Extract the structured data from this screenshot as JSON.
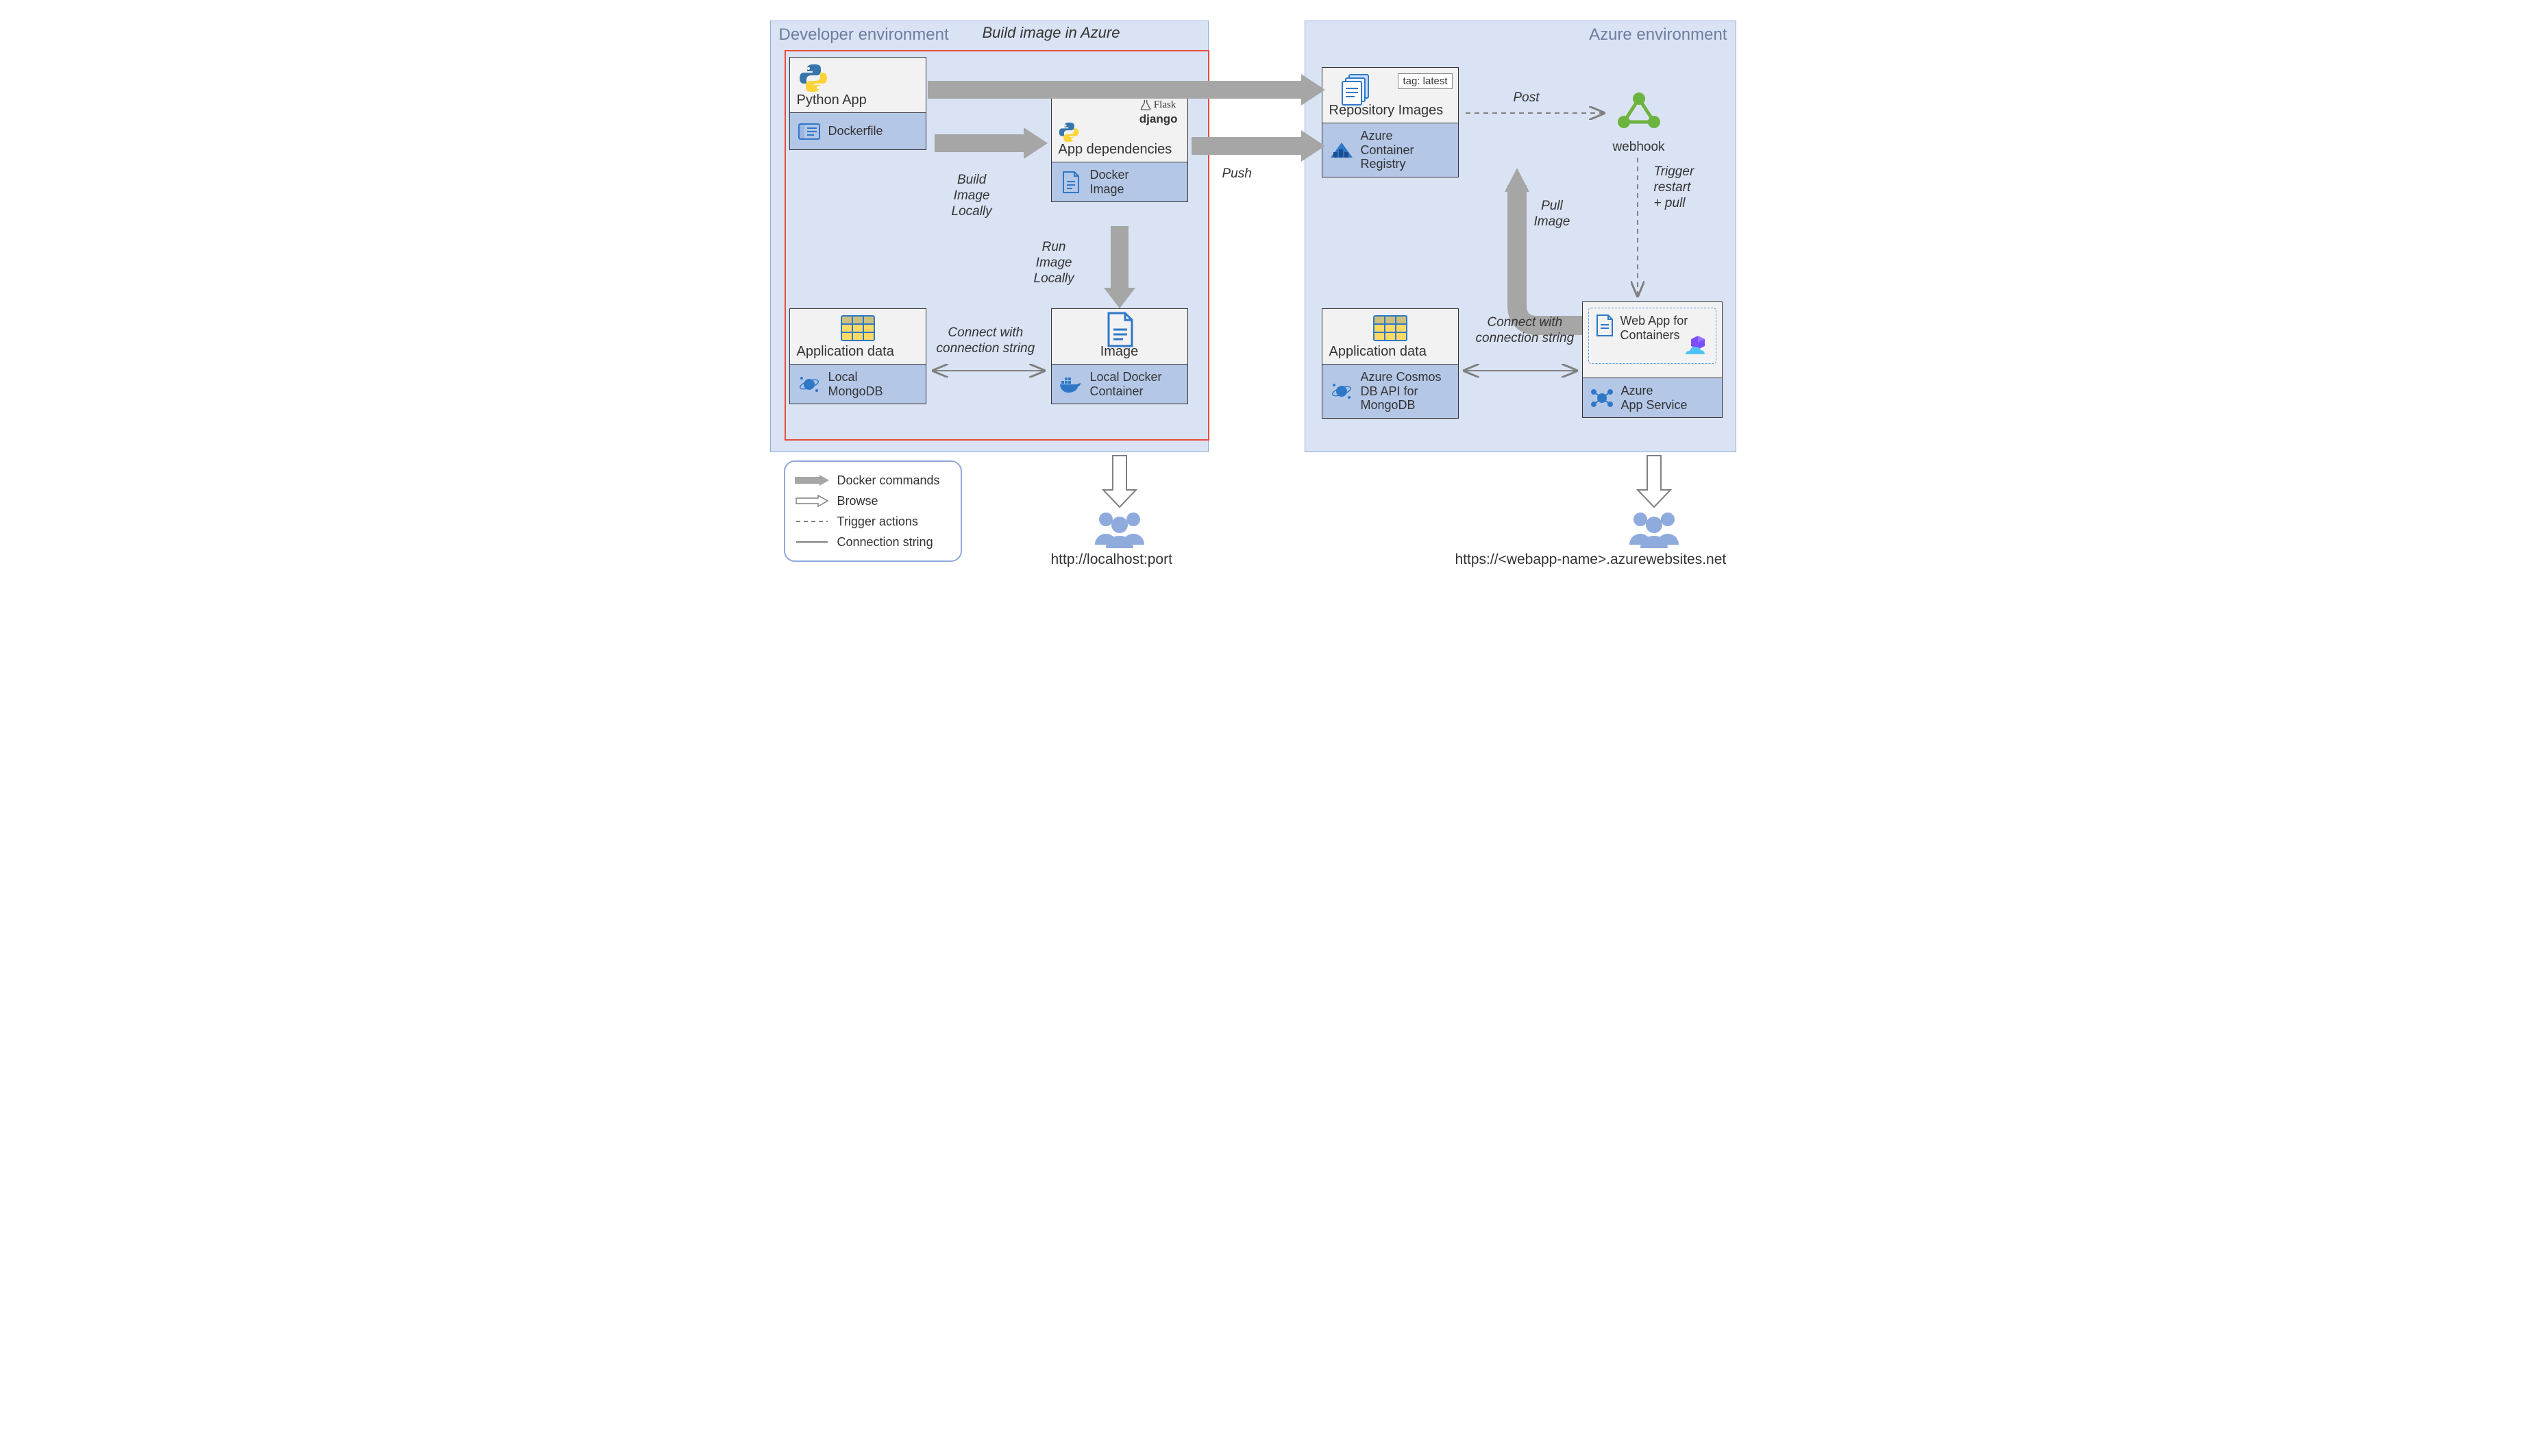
{
  "env": {
    "dev_label": "Developer environment",
    "azure_label": "Azure environment"
  },
  "labels": {
    "build_in_azure": "Build image in Azure",
    "build_locally": "Build\nImage\nLocally",
    "run_locally": "Run\nImage\nLocally",
    "conn_string": "Connect with\nconnection string",
    "conn_string2": "Connect with\nconnection string",
    "push": "Push",
    "post": "Post",
    "trigger": "Trigger\nrestart\n+ pull",
    "pull_image": "Pull\nImage",
    "tag_latest": "tag: latest"
  },
  "boxes": {
    "python_app": {
      "title": "Python App",
      "sub": "Dockerfile"
    },
    "app_deps": {
      "title": "App dependencies",
      "sub": "Docker\nImage",
      "frameworks": [
        "Flask",
        "django"
      ]
    },
    "app_data_local": {
      "title": "Application data",
      "sub": "Local\nMongoDB"
    },
    "image": {
      "title": "Image",
      "sub": "Local Docker\nContainer"
    },
    "repo_images": {
      "title": "Repository Images",
      "sub": "Azure\nContainer\nRegistry"
    },
    "webhook": "webhook",
    "app_data_cloud": {
      "title": "Application data",
      "sub": "Azure Cosmos\nDB API for\nMongoDB"
    },
    "web_app": {
      "title": "Web App for\nContainers",
      "sub": "Azure\nApp Service"
    }
  },
  "legend": {
    "docker": "Docker commands",
    "browse": "Browse",
    "trigger": "Trigger actions",
    "conn": "Connection string"
  },
  "urls": {
    "local": "http://localhost:port",
    "cloud": "https://<webapp-name>.azurewebsites.net"
  }
}
